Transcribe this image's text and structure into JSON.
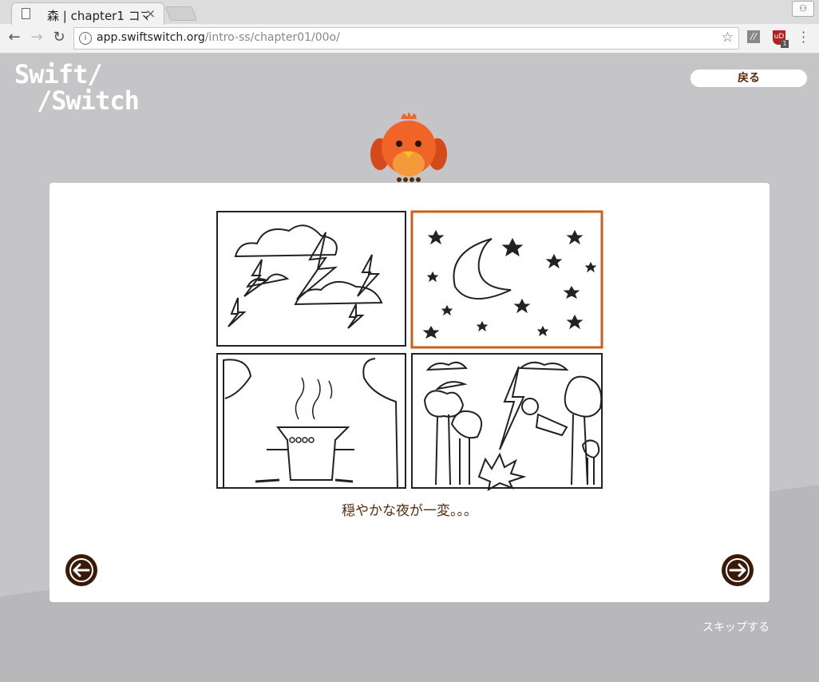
{
  "browser": {
    "tab_title": "森 | chapter1 コマ",
    "tab_close": "×",
    "url_domain": "app.swiftswitch.org",
    "url_path": "/intro-ss/chapter01/00o/",
    "info_glyph": "i",
    "star_glyph": "☆",
    "ext1_label": "//",
    "ext2_label": "uD",
    "ext2_badge": "1"
  },
  "app": {
    "logo_line1": "Swift/",
    "logo_line2": "/Switch",
    "back_button": "戻る",
    "caption": "穏やかな夜が一変。。。",
    "skip": "スキップする"
  },
  "colors": {
    "accent_brown": "#5a2a0a",
    "arrow_dark": "#3a1906",
    "bird_orange": "#f0642a",
    "highlight_panel": "#c8601e",
    "background": "#c5c5c7"
  },
  "comic_panels": [
    {
      "name": "storm-clouds",
      "selected": false
    },
    {
      "name": "night-sky",
      "selected": true
    },
    {
      "name": "cooking-pot",
      "selected": false
    },
    {
      "name": "forest-lightning",
      "selected": false
    }
  ]
}
